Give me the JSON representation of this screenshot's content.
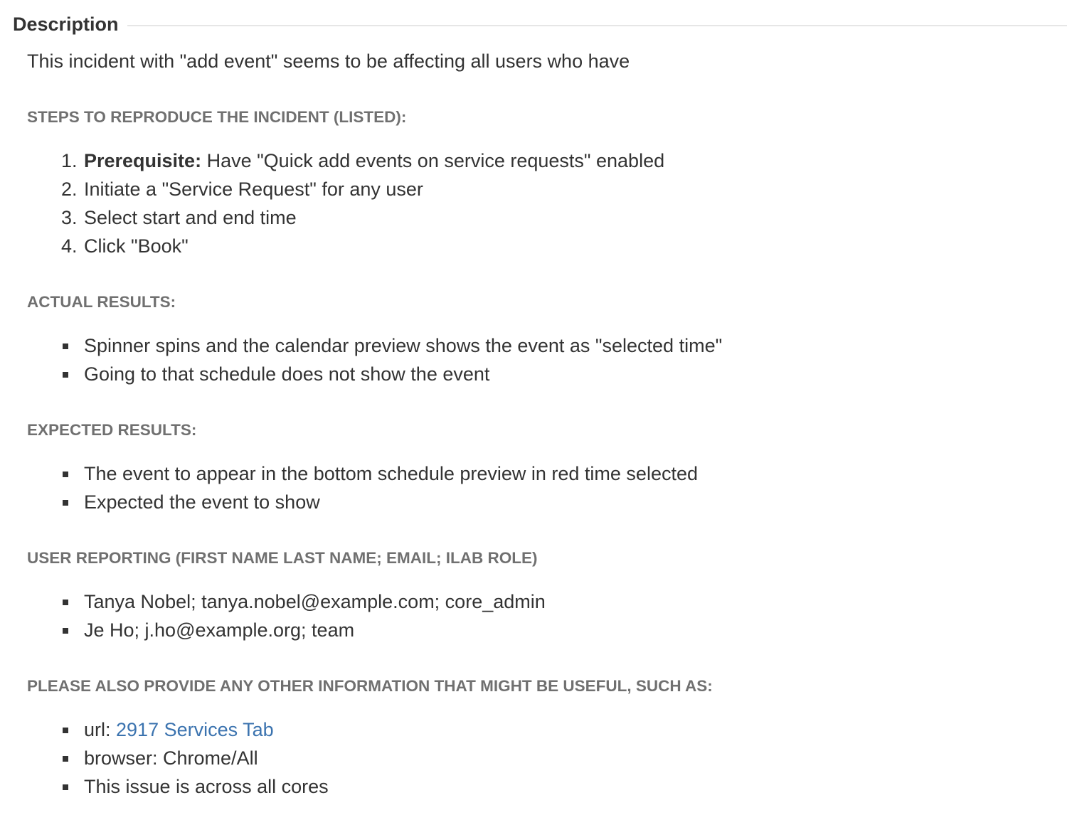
{
  "section": {
    "title": "Description"
  },
  "intro": "This incident with \"add event\" seems to be affecting all users who have",
  "steps": {
    "heading": "STEPS TO REPRODUCE THE INCIDENT (LISTED):",
    "items": [
      {
        "num": "1.",
        "bold": "Prerequisite:",
        "text": " Have \"Quick add events on service requests\" enabled"
      },
      {
        "num": "2.",
        "text": "Initiate a \"Service Request\" for any user"
      },
      {
        "num": "3.",
        "text": "Select start and end time"
      },
      {
        "num": "4.",
        "text": "Click \"Book\""
      }
    ]
  },
  "actual": {
    "heading": "ACTUAL RESULTS:",
    "items": [
      "Spinner spins and the calendar preview shows the event as \"selected time\"",
      "Going to that schedule does not show the event"
    ]
  },
  "expected": {
    "heading": "EXPECTED RESULTS:",
    "items": [
      "The event to appear in the bottom schedule preview in red time selected",
      "Expected the event to show"
    ]
  },
  "users": {
    "heading": "USER REPORTING (FIRST NAME LAST NAME; EMAIL; ILAB ROLE)",
    "items": [
      "Tanya Nobel; tanya.nobel@example.com; core_admin",
      "Je Ho; j.ho@example.org; team"
    ]
  },
  "other": {
    "heading": "PLEASE ALSO PROVIDE ANY OTHER INFORMATION THAT MIGHT BE USEFUL, SUCH AS:",
    "url_label": "url: ",
    "url_link": "2917 Services Tab",
    "browser": "browser: Chrome/All",
    "note": "This issue is across all cores"
  },
  "colors": {
    "text": "#333333",
    "heading": "#707070",
    "link": "#3b73af",
    "rule": "#e6e6e6"
  }
}
